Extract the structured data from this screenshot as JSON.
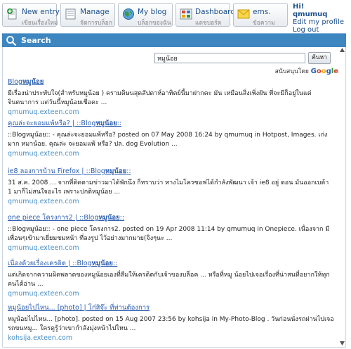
{
  "toolbar": {
    "new_entry": {
      "label": "New entry",
      "sub": "เขียนเรื่องใหม่"
    },
    "manage": {
      "label": "Manage",
      "sub": "จัดการบล็อก"
    },
    "my_blog": {
      "label": "My blog",
      "sub": "บล็อกของฉัน"
    },
    "dashboard": {
      "label": "Dashboard",
      "sub": "แดชบอร์ด"
    },
    "ems": {
      "label": "ems.",
      "sub": "ข้อความ"
    }
  },
  "user": {
    "greeting": "Hi!",
    "name": "qmumuq",
    "edit_profile": "Edit my profile",
    "logout": "Log out"
  },
  "search": {
    "header": "Search",
    "query": "หมูน้อย",
    "button": "ค้นหา",
    "powered_by": "สนับสนุนโดย"
  },
  "results": [
    {
      "title_pre": "Blog",
      "title_bold": "หมูน้อย",
      "title_post": "",
      "snippet": "มีเรื่องน่าประทับใจ(สำหรับหมูน้อย ) ครามดิษนสุดสัปดาห์อาทิตย์นี้มาฝากคะ มัน เหมือนสิ่งเพิ่งฝัน ที่จะมีก็อยู่ในแต่จินตนาการ แต่วันนี้หมูน้อยเชื่อคะ ...",
      "url": "qmumuq.exteen.com"
    },
    {
      "title_pre": "คุณล่ะจะยอมแพ้หรือ? | ::Blog",
      "title_bold": "หมูน้อย",
      "title_post": "::",
      "snippet": "::Blogหมูน้อย:: - คุณล่ะจะยอมแพ้หรือ? posted on 07 May 2008 16:24 by qmumuq in Hotpost, Images. เก่งมาก หมาน้อย. คุณล่ะ จะยอมแพ้ หรือ? ปล. dog Evolution ...",
      "url": "qmumuq.exteen.com"
    },
    {
      "title_pre": "ie8 ลองการบ้าน Firefox | ::Blog",
      "title_bold": "หมูน้อย",
      "title_post": "::",
      "snippet": "31 ส.ค. 2008 ... จากที่ติดตามข่าวมาได้พักนึง ก็ทราบว่า ทางไมโครซอฟได้กำลังพัฒนา เจ้า ie8 อยู่ ตอน มันออกเบต้า 1 มาก็ไม่สนใจอะไร เพราะปกติหมูน้อย ...",
      "url": "qmumuq.exteen.com"
    },
    {
      "title_pre": "one piece โครงการ2 | ::Blog",
      "title_bold": "หมูน้อย",
      "title_post": "::",
      "snippet": "::Blogหมูน้อย:: - one piece โครงการ2. posted on 19 Apr 2008 11:14 by qmumuq in Onepiece. เนื่องจาก มีเพื่อนๆเข้ามาเยี่ยมชมหน้า ที่ลงรูป ไว้อย่างมากมาย(จิงๆนะ ...",
      "url": "qmumuq.exteen.com"
    },
    {
      "title_pre": "เนื่องด้วยเรื่องเครดิต | ::Blog",
      "title_bold": "หมูน้อย",
      "title_post": "::",
      "snippet": "แต่เกิดจากความผิดพลาดของหมูน้อยเองที่ลืมให้เครดิตกับเจ้าของบล็อค ... หรือที่หมู น้อยไปเจอเรื่องที่น่าสนที่อยากให้ทุกคนได้อ่าน ...",
      "url": "qmumuq.exteen.com"
    },
    {
      "title_pre": "หมูน้อยไปไหน... [photo] | โก๋สิจ๊ะ ที่ท่านต้องการ",
      "title_bold": "",
      "title_post": "",
      "snippet": "หมูน้อยไปไหน... [photo]. posted on 15 Aug 2007 23:56 by kohsija in My-Photo-Blog . วันก่อนนั่งรถผ่านไปเจอรถขนหมู... ใครดูรู้ว่าเขากำลังมุ่งหน้าไปไหน ...",
      "url": "kohsija.exteen.com"
    }
  ]
}
